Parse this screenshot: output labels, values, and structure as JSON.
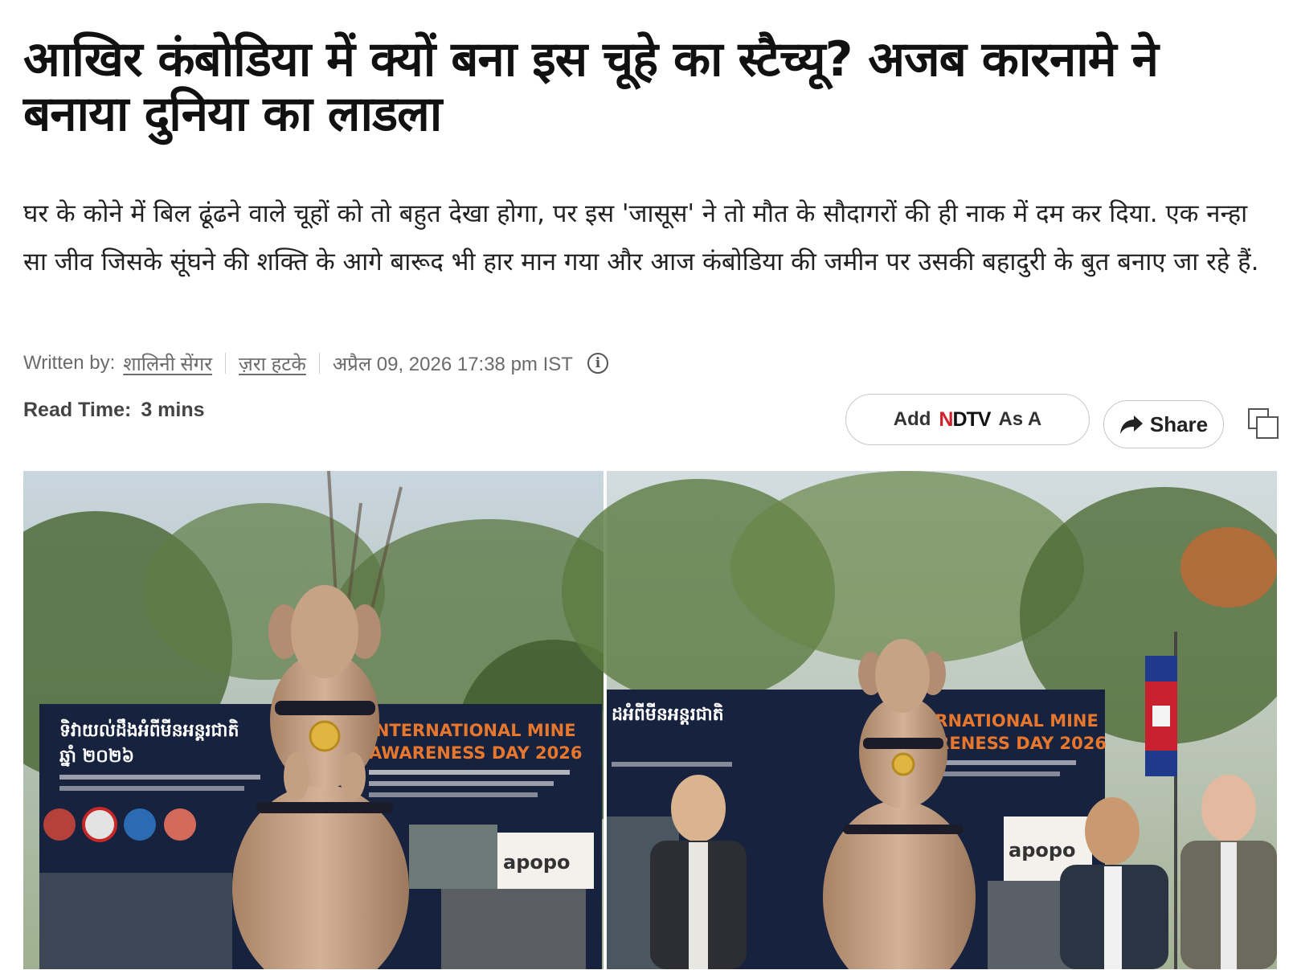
{
  "article": {
    "headline": "आखिर कंबोडिया में क्यों बना इस चूहे का स्टैच्यू? अजब कारनामे ने बनाया दुनिया का लाडला",
    "summary": "घर के कोने में बिल ढूंढने वाले चूहों को तो बहुत देखा होगा, पर इस 'जासूस' ने तो मौत के सौदागरों की ही नाक में दम कर दिया. एक नन्हा सा जीव जिसके सूंघने की शक्ति के आगे बारूद भी हार मान गया और आज कंबोडिया की जमीन पर उसकी बहादुरी के बुत बनाए जा रहे हैं."
  },
  "byline": {
    "written_by_label": "Written by:",
    "author": "शालिनी सेंगर",
    "category": "ज़रा हटके",
    "datetime": "अप्रैल 09, 2026 17:38 pm IST"
  },
  "read_time": {
    "label": "Read Time:",
    "value": "3 mins"
  },
  "actions": {
    "add_prefix": "Add",
    "ndtv_logo_text": "NDTV",
    "add_suffix": "As A",
    "share_label": "Share"
  },
  "icons": {
    "info": "info-icon",
    "share": "share-arrow-icon",
    "copy": "copy-icon"
  },
  "hero_image": {
    "left_banner_khmer": "ទិវាយល់ដឹងអំពីមីនអន្តរជាតិ",
    "left_banner_khmer_year": "ឆ្នាំ ២០២៦",
    "right_banner_khmer": "ដអំពីមីនអន្តរជាតិ",
    "left_banner_en_1": "INTERNATIONAL MINE",
    "left_banner_en_2": "AWARENESS DAY 2026",
    "right_banner_en_1": "ERNATIONAL MINE",
    "right_banner_en_2": "ARENESS DAY 2026",
    "logo_left": "apopo",
    "logo_right": "apopo"
  },
  "colors": {
    "headline": "#111111",
    "meta": "#6b6b6b",
    "ndtv_red": "#d1212a",
    "banner_navy": "#17223f",
    "banner_orange": "#e8772e",
    "statue": "#c9a58a"
  }
}
